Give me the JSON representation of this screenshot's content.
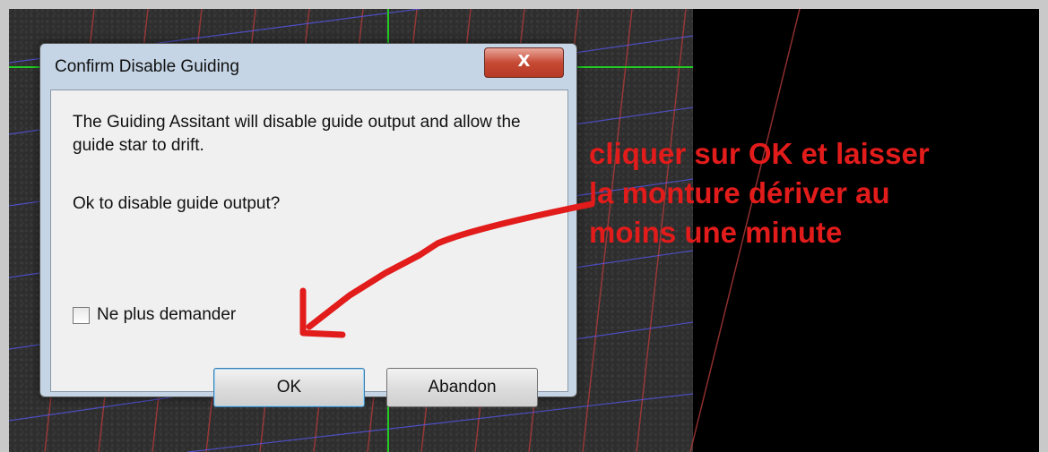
{
  "dialog": {
    "title": "Confirm Disable Guiding",
    "close_label": "X",
    "message": "The Guiding Assitant will disable guide output and allow the guide star to drift.",
    "question": "Ok to disable guide output?",
    "checkbox": {
      "label": "Ne plus demander",
      "checked": false
    },
    "buttons": {
      "ok": "OK",
      "abandon": "Abandon"
    }
  },
  "annotation": {
    "text": "cliquer sur OK et laisser\nla monture dériver au\nmoins une minute",
    "color": "#e21b1b"
  },
  "colors": {
    "guide_crosshair": "#22cc22",
    "grid_red": "#b13a3a",
    "grid_blue": "#5a5aff"
  }
}
